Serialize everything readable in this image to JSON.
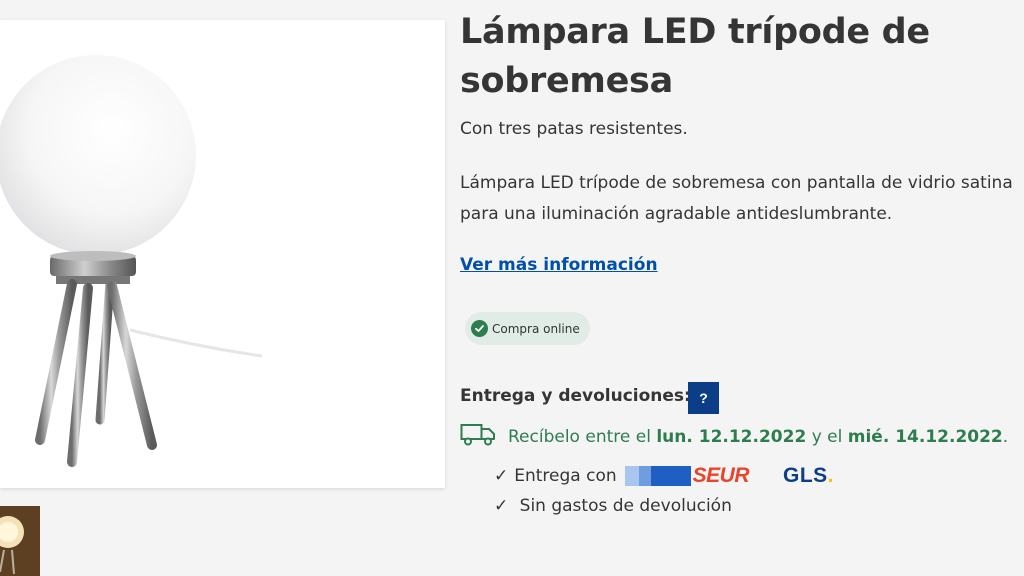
{
  "product": {
    "title": "Lámpara LED trípode de sobremesa",
    "subtitle": "Con tres patas resistentes.",
    "description_line1": "Lámpara LED trípode de sobremesa con pantalla de vidrio satina",
    "description_line2": "para una iluminación agradable antideslumbrante.",
    "more_info_link": "Ver más información",
    "badge_label": "Compra online",
    "badge_icon": "check-circle-icon"
  },
  "delivery": {
    "heading": "Entrega y devoluciones:",
    "help_label": "?",
    "truck_icon": "truck-icon",
    "receive_prefix": "Recíbelo entre el",
    "date_from": "lun. 12.12.2022",
    "connector": "y el",
    "date_to": "mié. 14.12.2022",
    "end_punct": ".",
    "carrier_check": "✓",
    "carrier_text": "Entrega con",
    "carrier_1": "SEUR",
    "carrier_2": "GLS",
    "carrier_2_dot": ".",
    "return_check": "✓",
    "return_text": "Sin gastos de devolución"
  },
  "colors": {
    "accent_blue": "#0050aa",
    "button_navy": "#0b3e87",
    "success_green": "#2e7d4f",
    "seur_red": "#e8442c",
    "gls_yellow": "#f2c314"
  }
}
